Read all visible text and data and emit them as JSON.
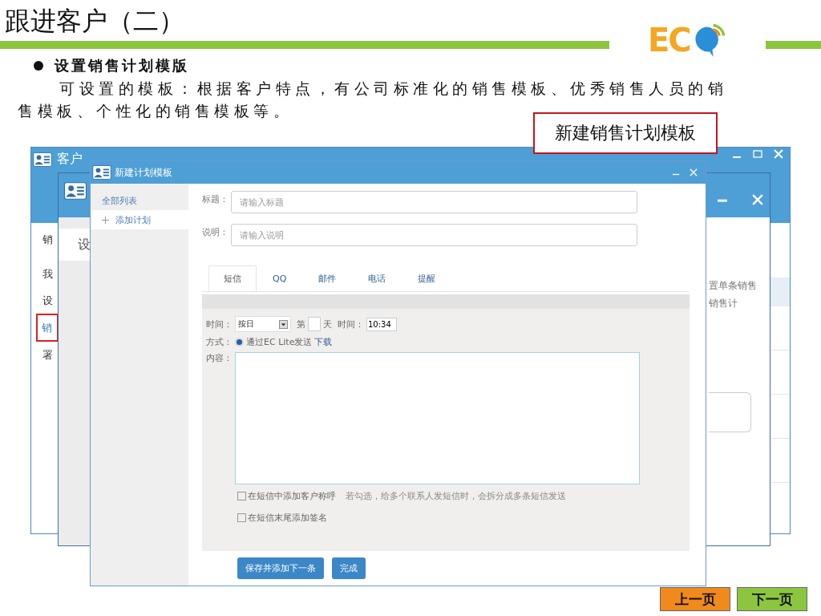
{
  "slide": {
    "title": "跟进客户（二）",
    "logo": "EC",
    "bullet": "设置销售计划模版",
    "paragraph": "可设置的模板：根据客户特点，有公司标准化的销售模板、优秀销售人员的销售模板、个性化的销售模板等。",
    "callout": "新建销售计划模板"
  },
  "back_window": {
    "title": "客户",
    "menu": [
      {
        "label": "销",
        "highlighted": false
      },
      {
        "label": "我",
        "highlighted": false
      },
      {
        "label": "设",
        "highlighted": false
      },
      {
        "label": "销",
        "highlighted": true
      },
      {
        "label": "署",
        "highlighted": false
      }
    ]
  },
  "middle_window": {
    "tab": "设",
    "notes": [
      "置单条销售",
      "销售计"
    ]
  },
  "dialog": {
    "title": "新建计划模板",
    "sidebar": [
      {
        "label": "全部列表",
        "kind": "header",
        "selected": false
      },
      {
        "label": "添加计划",
        "kind": "add",
        "selected": true
      }
    ],
    "fields": [
      {
        "label": "标题：",
        "placeholder": "请输入标题"
      },
      {
        "label": "说明：",
        "placeholder": "请输入说明"
      }
    ],
    "tabs": [
      {
        "label": "短信",
        "selected": true
      },
      {
        "label": "QQ",
        "selected": false
      },
      {
        "label": "邮件",
        "selected": false
      },
      {
        "label": "电话",
        "selected": false
      },
      {
        "label": "提醒",
        "selected": false
      }
    ],
    "schedule": {
      "label": "时间：",
      "mode": "按日",
      "prefix": "第",
      "unit": "天",
      "time_label": "时间：",
      "time": "10:34"
    },
    "method": {
      "label": "方式：",
      "option": "通过EC Lite发送",
      "selected": true,
      "link": "下载"
    },
    "content_label": "内容：",
    "options": [
      {
        "label": "在短信中添加客户称呼",
        "hint": "若勾选，给多个联系人发短信时，会拆分成多条短信发送",
        "checked": false
      },
      {
        "label": "在短信末尾添加签名",
        "checked": false
      }
    ],
    "buttons": [
      "保存并添加下一条",
      "完成"
    ]
  },
  "nav": [
    {
      "label": "上一页",
      "color": "#f08a1c"
    },
    {
      "label": "下一页",
      "color": "#8cc63e"
    }
  ]
}
